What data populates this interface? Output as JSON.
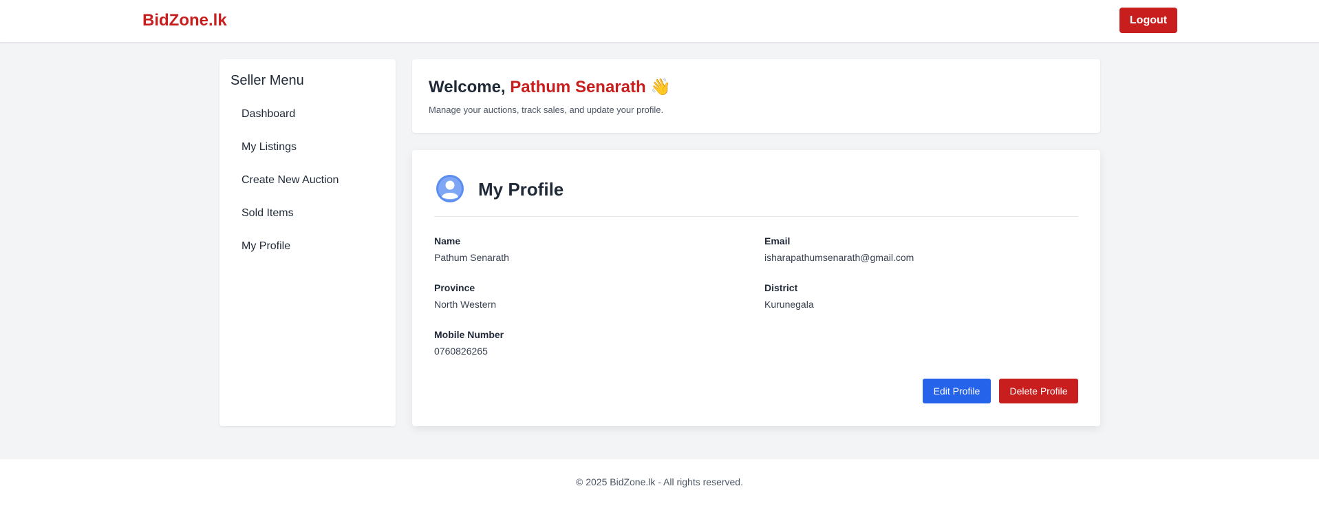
{
  "header": {
    "brand": "BidZone.lk",
    "logout_label": "Logout"
  },
  "sidebar": {
    "title": "Seller Menu",
    "items": [
      {
        "label": "Dashboard"
      },
      {
        "label": "My Listings"
      },
      {
        "label": "Create New Auction"
      },
      {
        "label": "Sold Items"
      },
      {
        "label": "My Profile"
      }
    ]
  },
  "welcome": {
    "prefix": "Welcome, ",
    "name": "Pathum Senarath",
    "emoji": " 👋",
    "subtitle": "Manage your auctions, track sales, and update your profile."
  },
  "profile": {
    "title": "My Profile",
    "avatar_icon": "user-avatar-icon",
    "fields": {
      "name": {
        "label": "Name",
        "value": "Pathum Senarath"
      },
      "email": {
        "label": "Email",
        "value": "isharapathumsenarath@gmail.com"
      },
      "province": {
        "label": "Province",
        "value": "North Western"
      },
      "district": {
        "label": "District",
        "value": "Kurunegala"
      },
      "mobile": {
        "label": "Mobile Number",
        "value": "0760826265"
      }
    },
    "edit_label": "Edit Profile",
    "delete_label": "Delete Profile"
  },
  "footer": {
    "text": "© 2025 BidZone.lk - All rights reserved."
  },
  "colors": {
    "brand": "#c81e1e",
    "primary": "#2563eb",
    "background": "#f3f4f6"
  }
}
